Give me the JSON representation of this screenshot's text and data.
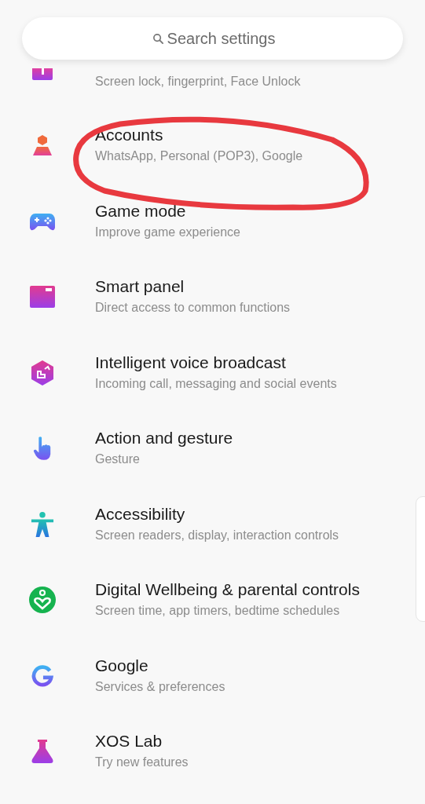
{
  "search": {
    "placeholder": "Search settings"
  },
  "items": [
    {
      "kind": "partial",
      "subtitle": "Screen lock, fingerprint, Face Unlock"
    },
    {
      "kind": "full",
      "title": "Accounts",
      "subtitle": "WhatsApp, Personal (POP3), Google",
      "circled": true
    },
    {
      "kind": "full",
      "title": "Game mode",
      "subtitle": "Improve game experience",
      "circled": false
    },
    {
      "kind": "full",
      "title": "Smart panel",
      "subtitle": "Direct access to common functions",
      "circled": false
    },
    {
      "kind": "full",
      "title": "Intelligent voice broadcast",
      "subtitle": "Incoming call, messaging and social events",
      "circled": false
    },
    {
      "kind": "full",
      "title": "Action and gesture",
      "subtitle": "Gesture",
      "circled": false
    },
    {
      "kind": "full",
      "title": "Accessibility",
      "subtitle": "Screen readers, display, interaction controls",
      "circled": false
    },
    {
      "kind": "full",
      "title": "Digital Wellbeing & parental controls",
      "subtitle": "Screen time, app timers, bedtime schedules",
      "circled": false
    },
    {
      "kind": "full",
      "title": "Google",
      "subtitle": "Services & preferences",
      "circled": false
    },
    {
      "kind": "full",
      "title": "XOS Lab",
      "subtitle": "Try new features",
      "circled": false
    }
  ]
}
